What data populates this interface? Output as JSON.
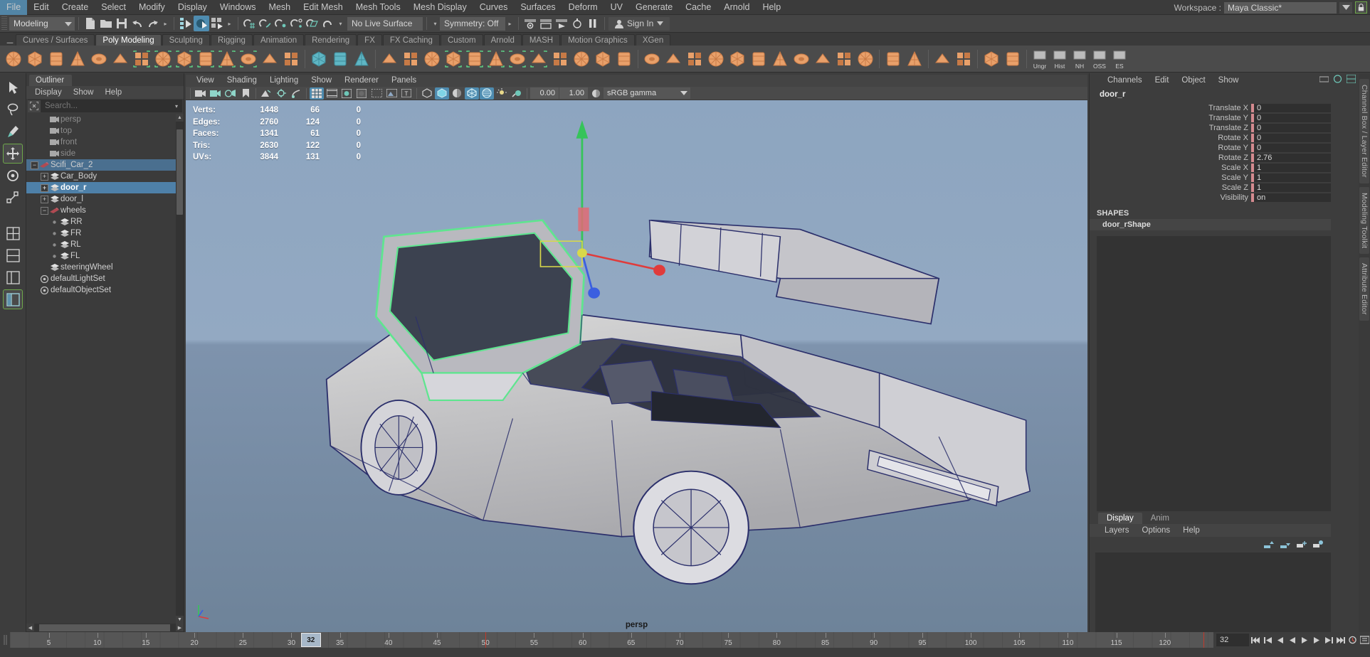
{
  "menubar": {
    "items": [
      "File",
      "Edit",
      "Create",
      "Select",
      "Modify",
      "Display",
      "Windows",
      "Mesh",
      "Edit Mesh",
      "Mesh Tools",
      "Mesh Display",
      "Curves",
      "Surfaces",
      "Deform",
      "UV",
      "Generate",
      "Cache",
      "Arnold",
      "Help"
    ],
    "workspace_label": "Workspace :",
    "workspace_value": "Maya Classic*"
  },
  "statusline": {
    "mode": "Modeling",
    "live_surface": "No Live Surface",
    "symmetry": "Symmetry: Off",
    "signin": "Sign In"
  },
  "shelf": {
    "tabs": [
      "Curves / Surfaces",
      "Poly Modeling",
      "Sculpting",
      "Rigging",
      "Animation",
      "Rendering",
      "FX",
      "FX Caching",
      "Custom",
      "Arnold",
      "MASH",
      "Motion Graphics",
      "XGen"
    ],
    "active_tab": "Poly Modeling",
    "right_badges": [
      "Ungr",
      "Hist",
      "NH",
      "OSS",
      "ES"
    ]
  },
  "outliner": {
    "title": "Outliner",
    "menus": [
      "Display",
      "Show",
      "Help"
    ],
    "search_placeholder": "Search...",
    "items": [
      {
        "label": "persp",
        "type": "camera",
        "depth": 1,
        "state": "dim",
        "expander": "none"
      },
      {
        "label": "top",
        "type": "camera",
        "depth": 1,
        "state": "dim",
        "expander": "none"
      },
      {
        "label": "front",
        "type": "camera",
        "depth": 1,
        "state": "dim",
        "expander": "none"
      },
      {
        "label": "side",
        "type": "camera",
        "depth": 1,
        "state": "dim",
        "expander": "none"
      },
      {
        "label": "Scifi_Car_2",
        "type": "group",
        "depth": 0,
        "state": "selected-parent",
        "expander": "minus"
      },
      {
        "label": "Car_Body",
        "type": "mesh",
        "depth": 1,
        "state": "normal",
        "expander": "plus"
      },
      {
        "label": "door_r",
        "type": "mesh",
        "depth": 1,
        "state": "selected",
        "expander": "plus"
      },
      {
        "label": "door_l",
        "type": "mesh",
        "depth": 1,
        "state": "normal",
        "expander": "plus"
      },
      {
        "label": "wheels",
        "type": "group",
        "depth": 1,
        "state": "normal",
        "expander": "minus"
      },
      {
        "label": "RR",
        "type": "mesh",
        "depth": 2,
        "state": "normal",
        "expander": "dot"
      },
      {
        "label": "FR",
        "type": "mesh",
        "depth": 2,
        "state": "normal",
        "expander": "dot"
      },
      {
        "label": "RL",
        "type": "mesh",
        "depth": 2,
        "state": "normal",
        "expander": "dot"
      },
      {
        "label": "FL",
        "type": "mesh",
        "depth": 2,
        "state": "normal",
        "expander": "dot"
      },
      {
        "label": "steeringWheel",
        "type": "mesh",
        "depth": 1,
        "state": "normal",
        "expander": "none"
      },
      {
        "label": "defaultLightSet",
        "type": "set",
        "depth": 0,
        "state": "normal",
        "expander": "none"
      },
      {
        "label": "defaultObjectSet",
        "type": "set",
        "depth": 0,
        "state": "normal",
        "expander": "none"
      }
    ]
  },
  "viewport": {
    "menus": [
      "View",
      "Shading",
      "Lighting",
      "Show",
      "Renderer",
      "Panels"
    ],
    "exposure": "0.00",
    "gamma_value": "1.00",
    "color_space": "sRGB gamma",
    "camera_label": "persp",
    "hud": {
      "rows": [
        {
          "label": "Verts:",
          "total": "1448",
          "selected": "66",
          "third": "0"
        },
        {
          "label": "Edges:",
          "total": "2760",
          "selected": "124",
          "third": "0"
        },
        {
          "label": "Faces:",
          "total": "1341",
          "selected": "61",
          "third": "0"
        },
        {
          "label": "Tris:",
          "total": "2630",
          "selected": "122",
          "third": "0"
        },
        {
          "label": "UVs:",
          "total": "3844",
          "selected": "131",
          "third": "0"
        }
      ]
    }
  },
  "channelbox": {
    "menus": [
      "Channels",
      "Edit",
      "Object",
      "Show"
    ],
    "node_name": "door_r",
    "attributes": [
      {
        "label": "Translate X",
        "value": "0"
      },
      {
        "label": "Translate Y",
        "value": "0"
      },
      {
        "label": "Translate Z",
        "value": "0"
      },
      {
        "label": "Rotate X",
        "value": "0"
      },
      {
        "label": "Rotate Y",
        "value": "0"
      },
      {
        "label": "Rotate Z",
        "value": "2.76"
      },
      {
        "label": "Scale X",
        "value": "1"
      },
      {
        "label": "Scale Y",
        "value": "1"
      },
      {
        "label": "Scale Z",
        "value": "1"
      },
      {
        "label": "Visibility",
        "value": "on"
      }
    ],
    "shapes_header": "SHAPES",
    "shapes_item": "door_rShape",
    "vertical_tabs": [
      "Channel Box / Layer Editor",
      "Modeling Toolkit",
      "Attribute Editor"
    ]
  },
  "layer_editor": {
    "tabs": [
      "Display",
      "Anim"
    ],
    "active_tab": "Display",
    "menus": [
      "Layers",
      "Options",
      "Help"
    ]
  },
  "timeline": {
    "ticks": [
      "5",
      "10",
      "15",
      "20",
      "25",
      "30",
      "35",
      "40",
      "45",
      "50",
      "55",
      "60",
      "65",
      "70",
      "75",
      "80",
      "85",
      "90",
      "95",
      "100",
      "105",
      "110",
      "115",
      "120"
    ],
    "current_frame": "32",
    "frame_field": "32",
    "range_start": 1,
    "range_end": 124
  },
  "colors": {
    "accent_blue": "#4e8cb0",
    "select_green": "#6ea84a",
    "attr_pink": "#d48a8f",
    "selection_row": "#4e80a8",
    "viewport_top": "#8da5c0",
    "viewport_bottom": "#6e8399"
  }
}
